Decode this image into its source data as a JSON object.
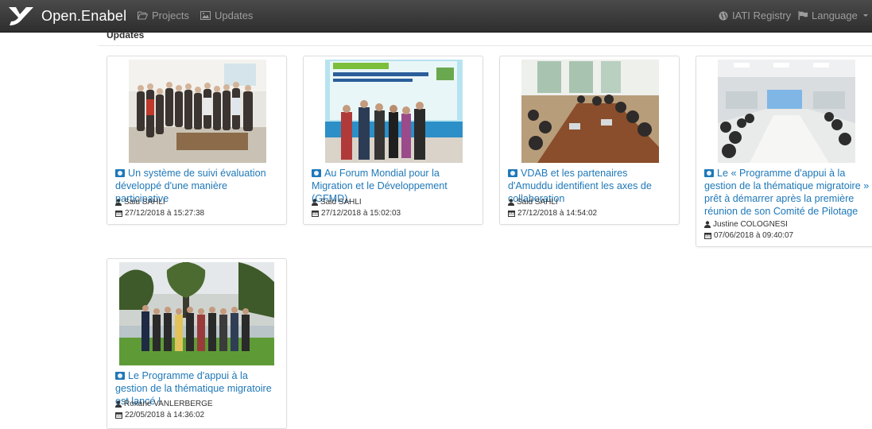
{
  "navbar": {
    "brand": "Open.Enabel",
    "projects_label": "Projects",
    "updates_label": "Updates",
    "iati_label": "IATI Registry",
    "language_label": "Language"
  },
  "section": {
    "title": "Updates"
  },
  "updates": [
    {
      "title": "Un système de suivi évaluation développé d'une manière participative",
      "author": "Said SAHLI",
      "date": "27/12/2018 à 15:27:38"
    },
    {
      "title": "Au Forum Mondial pour la Migration et le Développement (GFMD).",
      "author": "Said SAHLI",
      "date": "27/12/2018 à 15:02:03"
    },
    {
      "title": "VDAB et les partenaires d'Amuddu identifient les axes de collaboration",
      "author": "Said SAHLI",
      "date": "27/12/2018 à 14:54:02"
    },
    {
      "title": "Le « Programme d'appui à la gestion de la thématique migratoire » prêt à démarrer après la première réunion de son Comité de Pilotage",
      "author": "Justine COLOGNESI",
      "date": "07/06/2018 à 09:40:07"
    },
    {
      "title": "Le Programme d'appui à la gestion de la thématique migratoire est lancé !",
      "author": "Roxane VANLERBERGE",
      "date": "22/05/2018 à 14:36:02"
    }
  ],
  "colors": {
    "link": "#1f78b8",
    "navbar": "#3a3a3a"
  }
}
